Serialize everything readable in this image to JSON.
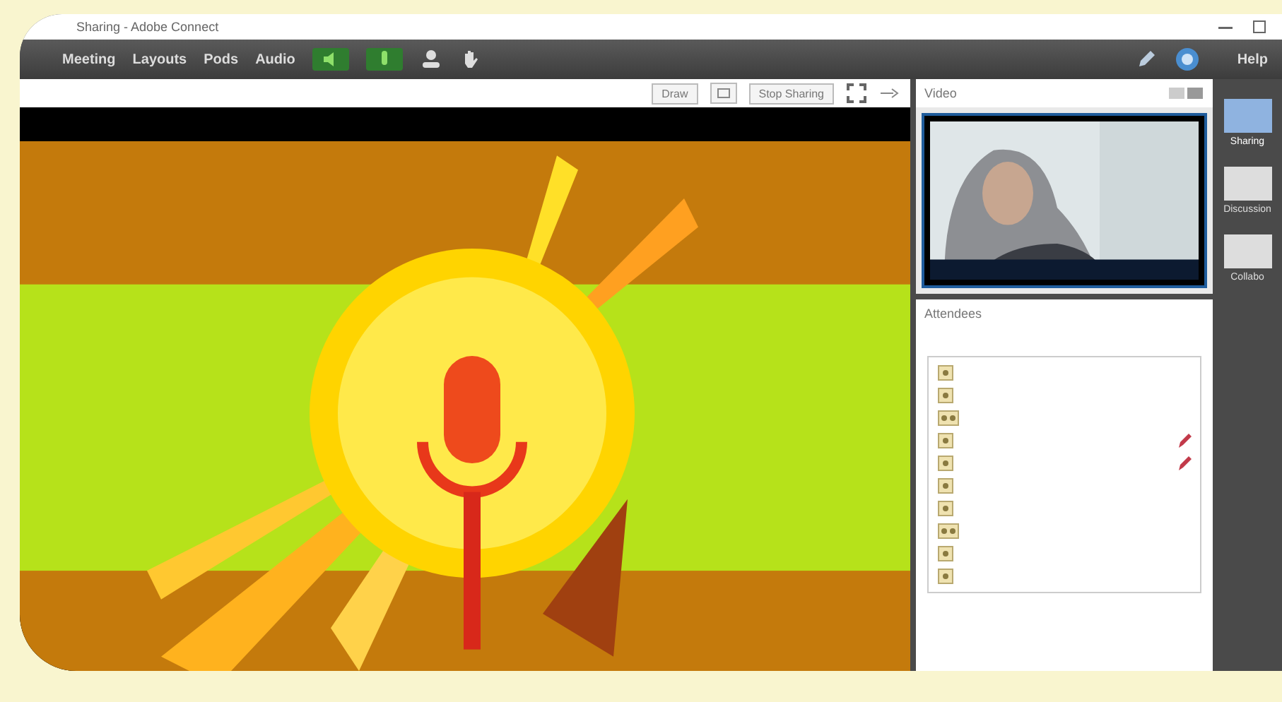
{
  "window": {
    "title": "Sharing - Adobe Connect"
  },
  "menu": [
    "Meeting",
    "Layouts",
    "Pods",
    "Audio"
  ],
  "audio": {
    "speaker_on": true,
    "mic_on": true
  },
  "help": "Help",
  "share_pod": {
    "buttons": [
      "Draw",
      "Stop Sharing"
    ],
    "content": {
      "kind": "picture"
    }
  },
  "video_pod": {
    "title": "Video",
    "feed": {
      "kind": "picture"
    }
  },
  "attendees": {
    "title": "Attendees",
    "rows": [
      {
        "kind": "single",
        "flagged": false
      },
      {
        "kind": "single",
        "flagged": false
      },
      {
        "kind": "double",
        "flagged": false
      },
      {
        "kind": "single",
        "flagged": true
      },
      {
        "kind": "single",
        "flagged": true
      },
      {
        "kind": "single",
        "flagged": false
      },
      {
        "kind": "single",
        "flagged": false
      },
      {
        "kind": "double",
        "flagged": false
      },
      {
        "kind": "single",
        "flagged": false
      },
      {
        "kind": "single",
        "flagged": false
      }
    ]
  },
  "layouts": [
    {
      "label": "Sharing",
      "selected": true
    },
    {
      "label": "Discussion",
      "selected": false
    },
    {
      "label": "Collabo",
      "selected": false
    }
  ]
}
